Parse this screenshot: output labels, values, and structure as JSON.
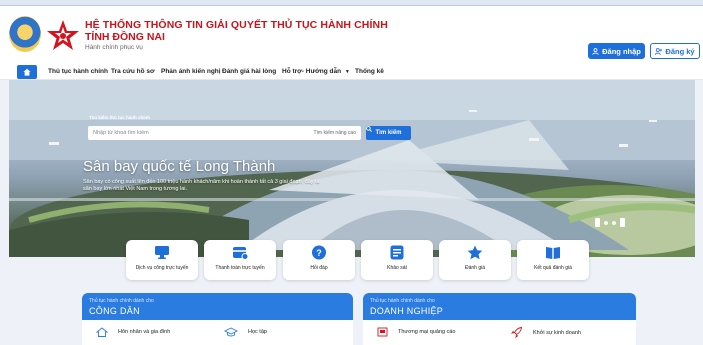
{
  "header": {
    "title_line1": "HỆ THỐNG THÔNG TIN GIẢI QUYẾT THỦ TỤC HÀNH CHÍNH",
    "title_line2": "TỈNH ĐỒNG NAI",
    "subtitle": "Hành chính phục vụ",
    "login_label": "Đăng nhập",
    "register_label": "Đăng ký"
  },
  "nav": {
    "items": [
      "Thủ tục hành chính",
      "Tra cứu hồ sơ",
      "Phản ánh kiến nghị",
      "Đánh giá hài lòng",
      "Hỗ trợ- Hướng dẫn",
      "Thống kê"
    ]
  },
  "search": {
    "label": "Tìm kiếm thủ tục hành chính",
    "placeholder": "Nhập từ khoá tìm kiếm",
    "advanced_label": "Tìm kiếm nâng cao",
    "button_label": "Tìm kiếm"
  },
  "hero": {
    "title": "Sân bay quốc tế Long Thành",
    "description": "Sân bay có công suất lên đến 100 triệu hành khách/năm khi hoàn thành tất cả 3 giai đoạn, đây là sân bay lớn nhất Việt Nam trong tương lai."
  },
  "services": [
    {
      "label": "Dịch vụ công trực tuyến",
      "icon": "monitor-icon",
      "color": "#1e6fd9"
    },
    {
      "label": "Thanh toán trực tuyến",
      "icon": "payment-icon",
      "color": "#1e6fd9"
    },
    {
      "label": "Hỏi đáp",
      "icon": "question-icon",
      "color": "#1e6fd9"
    },
    {
      "label": "Khảo sát",
      "icon": "survey-icon",
      "color": "#1e6fd9"
    },
    {
      "label": "Đánh giá",
      "icon": "star-icon",
      "color": "#1e6fd9"
    },
    {
      "label": "Kết quả đánh giá",
      "icon": "book-icon",
      "color": "#1e6fd9"
    }
  ],
  "panels": {
    "citizen": {
      "small": "Thủ tục hành chính dành cho",
      "big": "CÔNG DÂN",
      "items": [
        "Hôn nhân và gia đình",
        "Học tập"
      ]
    },
    "business": {
      "small": "Thủ tục hành chính dành cho",
      "big": "DOANH NGHIỆP",
      "items": [
        "Thương mại quảng cáo",
        "Khởi sự kinh doanh"
      ]
    }
  },
  "colors": {
    "brand_red": "#c8141c",
    "accent_blue": "#1e6fd9",
    "panel_blue": "#2a7ce0"
  }
}
